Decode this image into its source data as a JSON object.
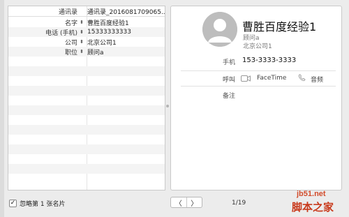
{
  "mapping": {
    "header": {
      "key": "通讯录",
      "value": "通讯录_2016081709065..."
    },
    "rows": [
      {
        "key": "名字",
        "value": "曹胜百度经验1"
      },
      {
        "key": "电话 (手机)",
        "value": "15333333333"
      },
      {
        "key": "公司",
        "value": "北京公司1"
      },
      {
        "key": "职位",
        "value": "顾问a"
      }
    ]
  },
  "card": {
    "name": "曹胜百度经验1",
    "title": "顾问a",
    "company": "北京公司1",
    "phone_label": "手机",
    "phone_value": "153-3333-3333",
    "call_label": "呼叫",
    "facetime_label": "FaceTime",
    "audio_label": "音频",
    "notes_label": "备注"
  },
  "footer": {
    "skip_label": "忽略第 1 张名片",
    "skip_checked": true,
    "prev_glyph": "〈",
    "next_glyph": "〉",
    "page_counter": "1/19"
  },
  "watermark": {
    "domain": "jb51.net",
    "site": "脚本之家"
  },
  "icons": {
    "avatar": "person-silhouette-icon",
    "video": "video-camera-icon",
    "phone": "phone-handset-icon",
    "dropdown": "updown-chevron-icon",
    "check": "checkmark-icon"
  }
}
